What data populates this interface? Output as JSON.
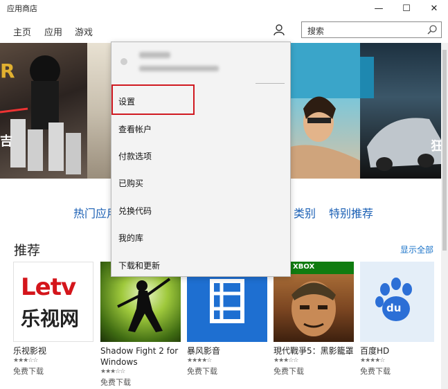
{
  "window": {
    "title": "应用商店",
    "minimize": "—",
    "maximize": "☐",
    "close": "✕"
  },
  "nav": {
    "items": [
      "主页",
      "应用",
      "游戏"
    ]
  },
  "search": {
    "placeholder": "搜索"
  },
  "categories": {
    "left": "热门应用",
    "right1": "类别",
    "right2": "特别推荐"
  },
  "hero_labels": {
    "left": "R",
    "left2": "吉",
    "right": "狂"
  },
  "section": {
    "title": "推荐",
    "show_all": "显示全部"
  },
  "menu": {
    "items": [
      "设置",
      "查看帐户",
      "付款选项",
      "已购买",
      "兑换代码",
      "我的库",
      "下载和更新"
    ]
  },
  "apps": [
    {
      "name": "乐视影视",
      "stars": "★★★☆☆",
      "rating": 3,
      "price": "免费下载",
      "logo1": "Letv",
      "logo2": "乐视网"
    },
    {
      "name": "Shadow Fight 2 for Windows",
      "stars": "★★★☆☆",
      "rating": 3,
      "price": "免费下载"
    },
    {
      "name": "暴风影音",
      "stars": "★★★★☆",
      "rating": 4,
      "price": "免费下载"
    },
    {
      "name": "現代戰爭5：黑影籠罩",
      "stars": "★★★☆☆",
      "rating": 3,
      "price": "免费下载",
      "banner": "XBOX"
    },
    {
      "name": "百度HD",
      "stars": "★★★★☆",
      "rating": 4,
      "price": "免费下载",
      "logo": "du"
    }
  ],
  "colors": {
    "accent": "#1a5fb4",
    "highlight": "#d0181f",
    "xbox_green": "#107c10",
    "baofeng_blue": "#1e6fd1"
  }
}
